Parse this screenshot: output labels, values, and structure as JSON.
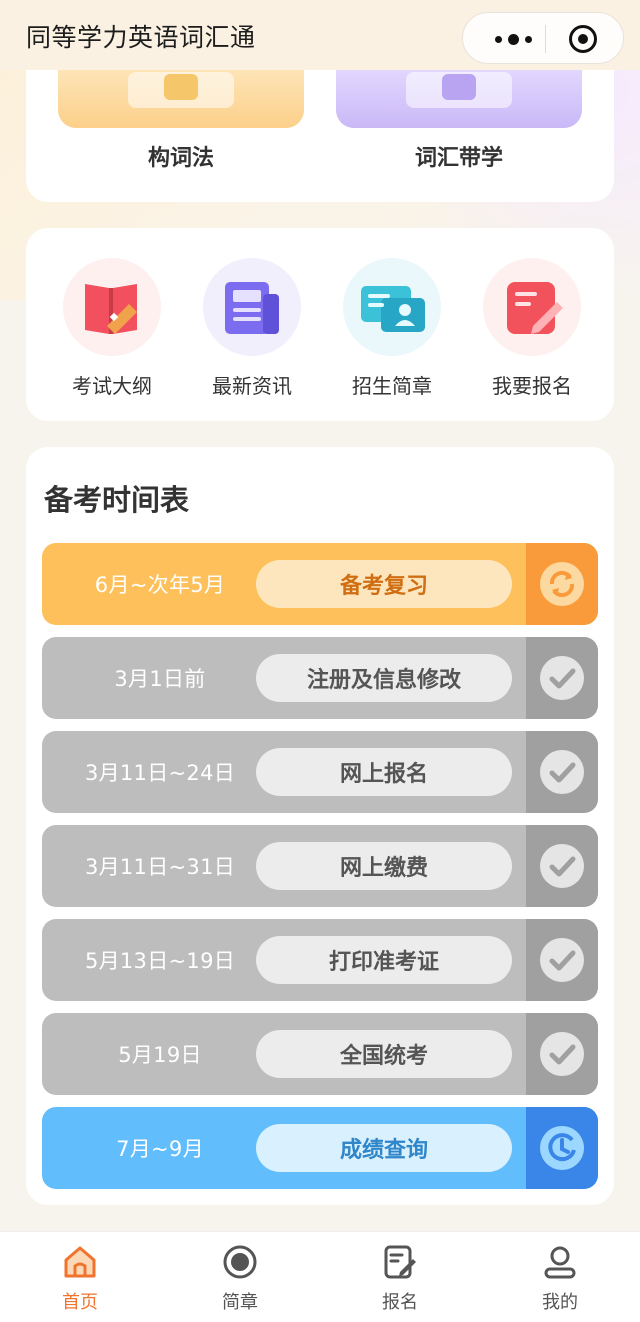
{
  "header": {
    "title": "同等学力英语词汇通"
  },
  "features": [
    {
      "label": "构词法",
      "color": "#fcd08a"
    },
    {
      "label": "词汇带学",
      "color": "#c9b8f6"
    }
  ],
  "quick_links": [
    {
      "label": "考试大纲",
      "icon": "book-icon"
    },
    {
      "label": "最新资讯",
      "icon": "news-icon"
    },
    {
      "label": "招生简章",
      "icon": "id-card-icon"
    },
    {
      "label": "我要报名",
      "icon": "edit-icon"
    }
  ],
  "schedule": {
    "title": "备考时间表",
    "rows": [
      {
        "date": "6月~次年5月",
        "event": "备考复习",
        "status": "in-progress",
        "status_icon": "refresh-icon"
      },
      {
        "date": "3月1日前",
        "event": "注册及信息修改",
        "status": "done",
        "status_icon": "check-icon"
      },
      {
        "date": "3月11日~24日",
        "event": "网上报名",
        "status": "done",
        "status_icon": "check-icon"
      },
      {
        "date": "3月11日~31日",
        "event": "网上缴费",
        "status": "done",
        "status_icon": "check-icon"
      },
      {
        "date": "5月13日~19日",
        "event": "打印准考证",
        "status": "done",
        "status_icon": "check-icon"
      },
      {
        "date": "5月19日",
        "event": "全国统考",
        "status": "done",
        "status_icon": "check-icon"
      },
      {
        "date": "7月~9月",
        "event": "成绩查询",
        "status": "upcoming",
        "status_icon": "clock-icon"
      }
    ]
  },
  "tabbar": {
    "items": [
      {
        "label": "首页",
        "icon": "home-icon",
        "active": true
      },
      {
        "label": "简章",
        "icon": "record-icon",
        "active": false
      },
      {
        "label": "报名",
        "icon": "edit-icon",
        "active": false
      },
      {
        "label": "我的",
        "icon": "user-icon",
        "active": false
      }
    ]
  },
  "colors": {
    "accent": "#f0742e",
    "in_progress": "#fdc05a",
    "done": "#bdbdbd",
    "upcoming": "#62bdfc"
  }
}
